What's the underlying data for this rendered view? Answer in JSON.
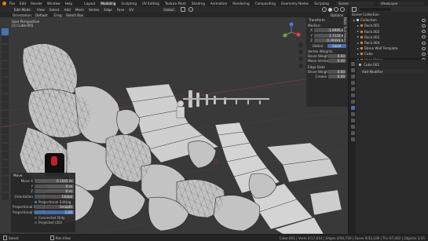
{
  "menubar": {
    "items": [
      "File",
      "Edit",
      "Render",
      "Window",
      "Help"
    ],
    "workspaces": [
      "Layout",
      "Modeling",
      "Sculpting",
      "UV Editing",
      "Texture Paint",
      "Shading",
      "Animation",
      "Rendering",
      "Compositing",
      "Geometry Nodes",
      "Scripting"
    ],
    "active_workspace": "Modeling",
    "scene": "Scene",
    "view_layer": "ViewLayer"
  },
  "header": {
    "mode": "Edit Mode",
    "menus": [
      "View",
      "Select",
      "Add",
      "Mesh",
      "Vertex",
      "Edge",
      "Face",
      "UV"
    ],
    "orientation": "Global",
    "options_label": "Options"
  },
  "toolbar2": {
    "orientation_label": "Orientation:",
    "orientation_value": "Default",
    "drag_label": "Drag:",
    "drag_value": "Select Box"
  },
  "viewport": {
    "view_name": "User Perspective",
    "object_name": "(1) Cube.001"
  },
  "n_panel": {
    "title": "Transform",
    "median_label": "Median:",
    "x_label": "X",
    "x": "-1.9995 m",
    "y_label": "Y",
    "y": "1.7133 m",
    "z_label": "Z",
    "z": "0.39393 m",
    "global_label": "Global",
    "local_label": "Local",
    "vertex_header": "Vertex Weights",
    "bevel_weight_label": "Bevel Weight",
    "bevel_weight": "0.00",
    "mean_crease_label": "Mean Vertex Crease",
    "mean_crease": "0.00",
    "edge_header": "Edge Data",
    "edge_bevel_label": "Bevel Weight",
    "edge_bevel": "0.00",
    "crease_label": "Crease",
    "crease": "0.00",
    "tabs": [
      "Item",
      "Tool",
      "View"
    ]
  },
  "outliner": {
    "title": "Scene Collection",
    "items": [
      {
        "name": "Collection",
        "color": "#d8d8d8"
      },
      {
        "name": "Rock.001",
        "color": "#e08a3c"
      },
      {
        "name": "Rock.002",
        "color": "#e08a3c"
      },
      {
        "name": "Rock.003",
        "color": "#e08a3c"
      },
      {
        "name": "Rock.004",
        "color": "#e08a3c"
      },
      {
        "name": "Stone Wall Template",
        "color": "#e08a3c"
      },
      {
        "name": "Cube",
        "color": "#e08a3c"
      },
      {
        "name": "Hero Stairs",
        "color": "#e08a3c"
      }
    ]
  },
  "properties": {
    "object_name": "Cube.001",
    "add_modifier": "Add Modifier"
  },
  "operator_panel": {
    "title": "Move",
    "move_x_label": "Move X",
    "move_x": "0.1645 m",
    "y_label": "Y",
    "y": "0 m",
    "z_label": "Z",
    "z": "0 m",
    "orientation_label": "Orientation",
    "orientation": "Global",
    "prop_label": "Proportional Editing",
    "falloff_label": "Proportional Falloff",
    "falloff": "Smooth",
    "size_label": "Proportional Size",
    "size": "1.00",
    "connected_label": "Connected Only",
    "projected_label": "Projected (2D)"
  },
  "statusbar": {
    "left": "Select",
    "middle": "Pan View",
    "right": "Cube.001 | Verts 0/17,614 | Edges 0/50,730 | Faces 0/33,106 | Tris 67,402 | Objects 1/35"
  }
}
